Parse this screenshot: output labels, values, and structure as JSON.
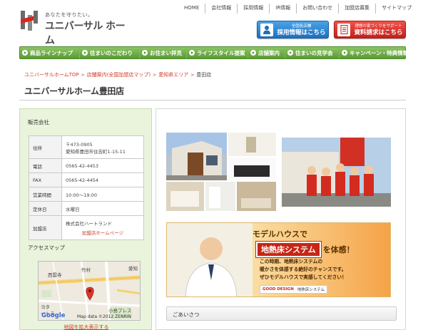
{
  "header": {
    "tagline": "あなたを守りたい。",
    "logo_text": "ユニバーサル ホーム",
    "top_nav": [
      "HOME",
      "会社情報",
      "採用情報",
      "IR情報",
      "お問い合わせ",
      "加盟店募集",
      "サイトマップ"
    ],
    "cta_recruit": {
      "sub": "全国各店舗",
      "main": "採用情報はこちら"
    },
    "cta_request": {
      "sub": "理想の家づくりをサポート",
      "main": "資料請求はこちら"
    }
  },
  "global_nav": [
    "商品ラインナップ",
    "住まいのこだわり",
    "お住まい拝見",
    "ライフスタイル提案",
    "店舗案内",
    "住まいの見学会",
    "キャンペーン・特典情報"
  ],
  "breadcrumb": [
    "ユニバーサルホームTOP",
    "店舗案内(全国加盟店マップ)",
    "愛知県エリア",
    "豊田店"
  ],
  "page_title": "ユニバーサルホーム豊田店",
  "sales_company": {
    "heading": "販売会社",
    "rows": [
      {
        "label": "住所",
        "lines": [
          "〒473-0905",
          "愛知県豊田市住吉町1-15-11"
        ]
      },
      {
        "label": "電話",
        "lines": [
          "0565-42-4453"
        ]
      },
      {
        "label": "FAX",
        "lines": [
          "0565-42-4454"
        ]
      },
      {
        "label": "営業時間",
        "lines": [
          "10:00～19:00"
        ]
      },
      {
        "label": "定休日",
        "lines": [
          "水曜日"
        ]
      },
      {
        "label": "加盟店",
        "lines": [
          "株式会社ハートランド"
        ],
        "link": "加盟店ホームページ"
      }
    ]
  },
  "access_map": {
    "heading": "アクセスマップ",
    "labels": {
      "a": "西雲寺",
      "b": "竹村",
      "c": "愛知",
      "d": "ヨタ",
      "e": "ートラ",
      "f": "小島プレス"
    },
    "attribution": "Map data ©2012 ZENRIN",
    "google": "Google",
    "enlarge_link": "地図を拡大表示する"
  },
  "banner": {
    "headline1": "モデルハウスで",
    "chip": "地熱床システム",
    "headline2_suffix": "を体感！",
    "body": [
      "この時期、地熱床システムの",
      "暖かさを体感する絶好のチャンスです。",
      "ぜひモデルハウスで実感してください！"
    ],
    "badge": "GOOD DESIGN",
    "caption": "地熱床システム"
  },
  "greeting": {
    "title": "ごあいさつ"
  },
  "colors": {
    "nav_green": "#5b9a34",
    "accent_red": "#d03b2a",
    "recruit_blue": "#1d6fc0"
  }
}
